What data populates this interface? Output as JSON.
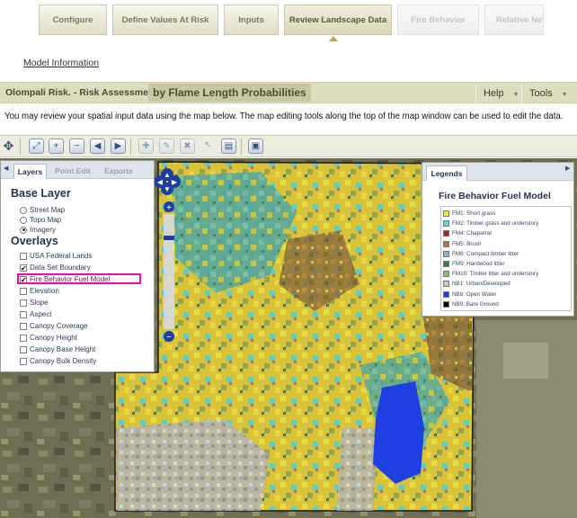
{
  "wizard": {
    "steps": [
      {
        "label": "Configure",
        "state": "done"
      },
      {
        "label": "Define Values At Risk",
        "state": "done"
      },
      {
        "label": "Inputs",
        "state": "done"
      },
      {
        "label": "Review Landscape Data",
        "state": "active"
      },
      {
        "label": "Fire Behavior",
        "state": "disabled"
      },
      {
        "label": "Relative Net V",
        "state": "disabled"
      }
    ]
  },
  "model_info_link": "Model Information",
  "titlebar": {
    "title": "Olompali Risk. - Risk Assessment -",
    "subtitle": "by Flame Length Probabilities",
    "help": "Help",
    "tools": "Tools"
  },
  "intro_text": "You may review your spatial input data using the map below. The map editing tools along the top of the map window can be used to edit the data.",
  "toolbar": {
    "icons": [
      "pan-icon",
      "zoom-extent-icon",
      "zoom-in-icon",
      "zoom-out-icon",
      "zoom-previous-icon",
      "zoom-next-icon",
      "add-point-icon",
      "edit-point-icon",
      "delete-point-icon",
      "select-icon",
      "table-icon",
      "save-icon"
    ]
  },
  "layers_panel": {
    "tabs": [
      "Layers",
      "Point Edit",
      "Exports"
    ],
    "base_layer_title": "Base Layer",
    "base_layers": [
      {
        "label": "Street Map",
        "selected": false
      },
      {
        "label": "Topo Map",
        "selected": false
      },
      {
        "label": "Imagery",
        "selected": true
      }
    ],
    "overlays_title": "Overlays",
    "overlays": [
      {
        "label": "USA Federal Lands",
        "checked": false
      },
      {
        "label": "Data Set Boundary",
        "checked": true
      },
      {
        "label": "Fire Behavior Fuel Model",
        "checked": true
      },
      {
        "label": "Elevation",
        "checked": false
      },
      {
        "label": "Slope",
        "checked": false
      },
      {
        "label": "Aspect",
        "checked": false
      },
      {
        "label": "Canopy Coverage",
        "checked": false
      },
      {
        "label": "Canopy Height",
        "checked": false
      },
      {
        "label": "Canopy Base Height",
        "checked": false
      },
      {
        "label": "Canopy Bulk Density",
        "checked": false
      }
    ]
  },
  "legend": {
    "tab": "Legends",
    "title": "Fire Behavior Fuel Model",
    "items": [
      {
        "label": "FM1: Short grass",
        "color": "#f5f021"
      },
      {
        "label": "FM2: Timber grass and understory",
        "color": "#5ed8d8"
      },
      {
        "label": "FM4: Chaparral",
        "color": "#a3281f"
      },
      {
        "label": "FM5: Brush",
        "color": "#b5763c"
      },
      {
        "label": "FM8: Compact timber litter",
        "color": "#8bb3d0"
      },
      {
        "label": "FM9: Hardwood litter",
        "color": "#2f7a61"
      },
      {
        "label": "FM10: Timber litter and understory",
        "color": "#8fbf6a"
      },
      {
        "label": "NB1: Urban/Developed",
        "color": "#c8c8c8"
      },
      {
        "label": "NB8: Open Water",
        "color": "#1f3fe0"
      },
      {
        "label": "NB9: Bare Ground",
        "color": "#000000"
      }
    ]
  }
}
